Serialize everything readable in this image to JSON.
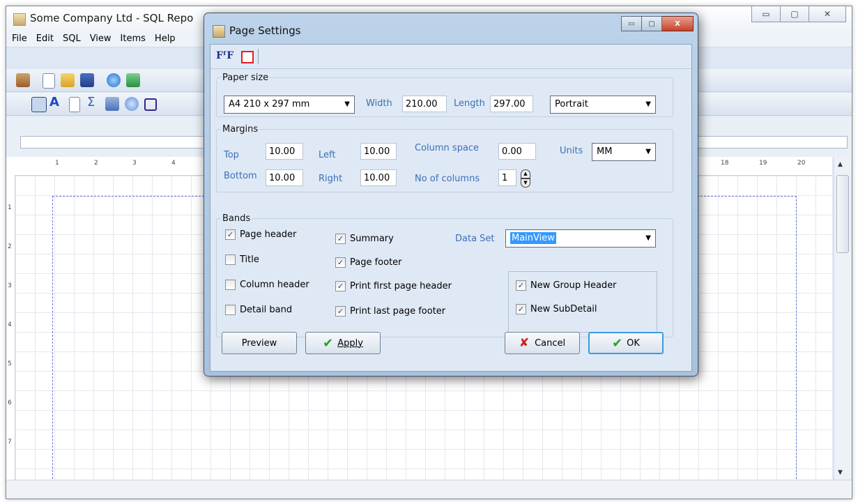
{
  "main_window": {
    "title": "Some Company Ltd - SQL Repo",
    "controls": {
      "minimize": "▭",
      "maximize": "▢",
      "close": "✕"
    },
    "menu": [
      "File",
      "Edit",
      "SQL",
      "View",
      "Items",
      "Help"
    ],
    "ruler_h": [
      "1",
      "2",
      "3",
      "4",
      "18",
      "19",
      "20"
    ],
    "ruler_v": [
      "1",
      "2",
      "3",
      "4",
      "5",
      "6",
      "7"
    ]
  },
  "dialog": {
    "title": "Page Settings",
    "controls": {
      "minimize": "▭",
      "maximize": "▢",
      "close": "X"
    },
    "toolbar": {
      "font_icon_text": "FᶠF"
    },
    "paper_size": {
      "legend": "Paper size",
      "size": "A4 210 x 297 mm",
      "width_label": "Width",
      "width": "210.00",
      "length_label": "Length",
      "length": "297.00",
      "orientation": "Portrait"
    },
    "margins": {
      "legend": "Margins",
      "top_label": "Top",
      "top": "10.00",
      "left_label": "Left",
      "left": "10.00",
      "column_space_label": "Column space",
      "column_space": "0.00",
      "units_label": "Units",
      "units": "MM",
      "bottom_label": "Bottom",
      "bottom": "10.00",
      "right_label": "Right",
      "right": "10.00",
      "columns_label": "No of columns",
      "columns": "1"
    },
    "bands": {
      "legend": "Bands",
      "page_header": "Page header",
      "title": "Title",
      "column_header": "Column header",
      "detail_band": "Detail band",
      "summary": "Summary",
      "page_footer": "Page footer",
      "print_first_page_header": "Print first page header",
      "print_last_page_footer": "Print last page footer",
      "data_set_label": "Data Set",
      "data_set": "MainView",
      "new_group_header": "New Group Header",
      "new_subdetail": "New SubDetail"
    },
    "buttons": {
      "preview": "Preview",
      "apply": "Apply",
      "cancel": "Cancel",
      "ok": "OK"
    },
    "check_mark": "✓"
  }
}
